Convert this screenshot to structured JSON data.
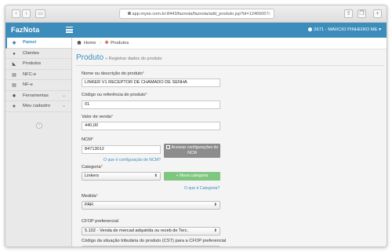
{
  "browser": {
    "url": "app.myse.com.br:8443/faznota/faznota/add_produto.jsp?id=1246500",
    "back_icon": "chevron-left-icon",
    "forward_icon": "chevron-right-icon"
  },
  "app": {
    "brand": "FazNota",
    "user": "2671 - MARCIO PINHEIRO ME",
    "user_caret": "▾"
  },
  "sidebar": {
    "items": [
      {
        "label": "Painel",
        "icon": "dashboard-icon",
        "glyph": "◆",
        "active": true
      },
      {
        "label": "Clientes",
        "icon": "user-icon",
        "glyph": "●"
      },
      {
        "label": "Produtos",
        "icon": "tags-icon",
        "glyph": "◣"
      },
      {
        "label": "NFC-e",
        "icon": "file-icon",
        "glyph": "▤"
      },
      {
        "label": "NF-e",
        "icon": "file-icon",
        "glyph": "▤"
      },
      {
        "label": "Ferramentas",
        "icon": "gear-icon",
        "glyph": "✹",
        "chevron": "⌄"
      },
      {
        "label": "Meu cadastro",
        "icon": "star-icon",
        "glyph": "★",
        "chevron": "⌄"
      }
    ]
  },
  "breadcrumb": {
    "home": "Home",
    "current": "Produtos",
    "current_prefix": "✚"
  },
  "page": {
    "title": "Produto",
    "subtitle": "» Registrar dados do produto"
  },
  "form": {
    "nome_label": "Nome ou descrição do produto",
    "nome_value": "LINKER V1 RECEPTOR DE CHAMADO DE SENHA",
    "codigo_label": "Código ou referência do produto",
    "codigo_value": "01",
    "valor_label": "Valor de venda",
    "valor_value": "440,00",
    "ncm_label": "NCM",
    "ncm_value": "84713012",
    "ncm_link": "O que é configuração de NCM?",
    "ncm_button": "Acessar configurações do NCM",
    "categoria_label": "Categoria",
    "categoria_value": "Linkers",
    "categoria_button": "+ Nova categoria",
    "categoria_link": "O que é Categoria?",
    "medida_label": "Medida",
    "medida_value": "PAR",
    "cfop_label": "CFOP preferencial",
    "cfop_value": "5.102 - Venda de mercad adquirida ou receb de Terc.",
    "cst_label": "Código da situação tributária do produto (CST) para a CFOP preferencial",
    "required_mark": "*"
  }
}
